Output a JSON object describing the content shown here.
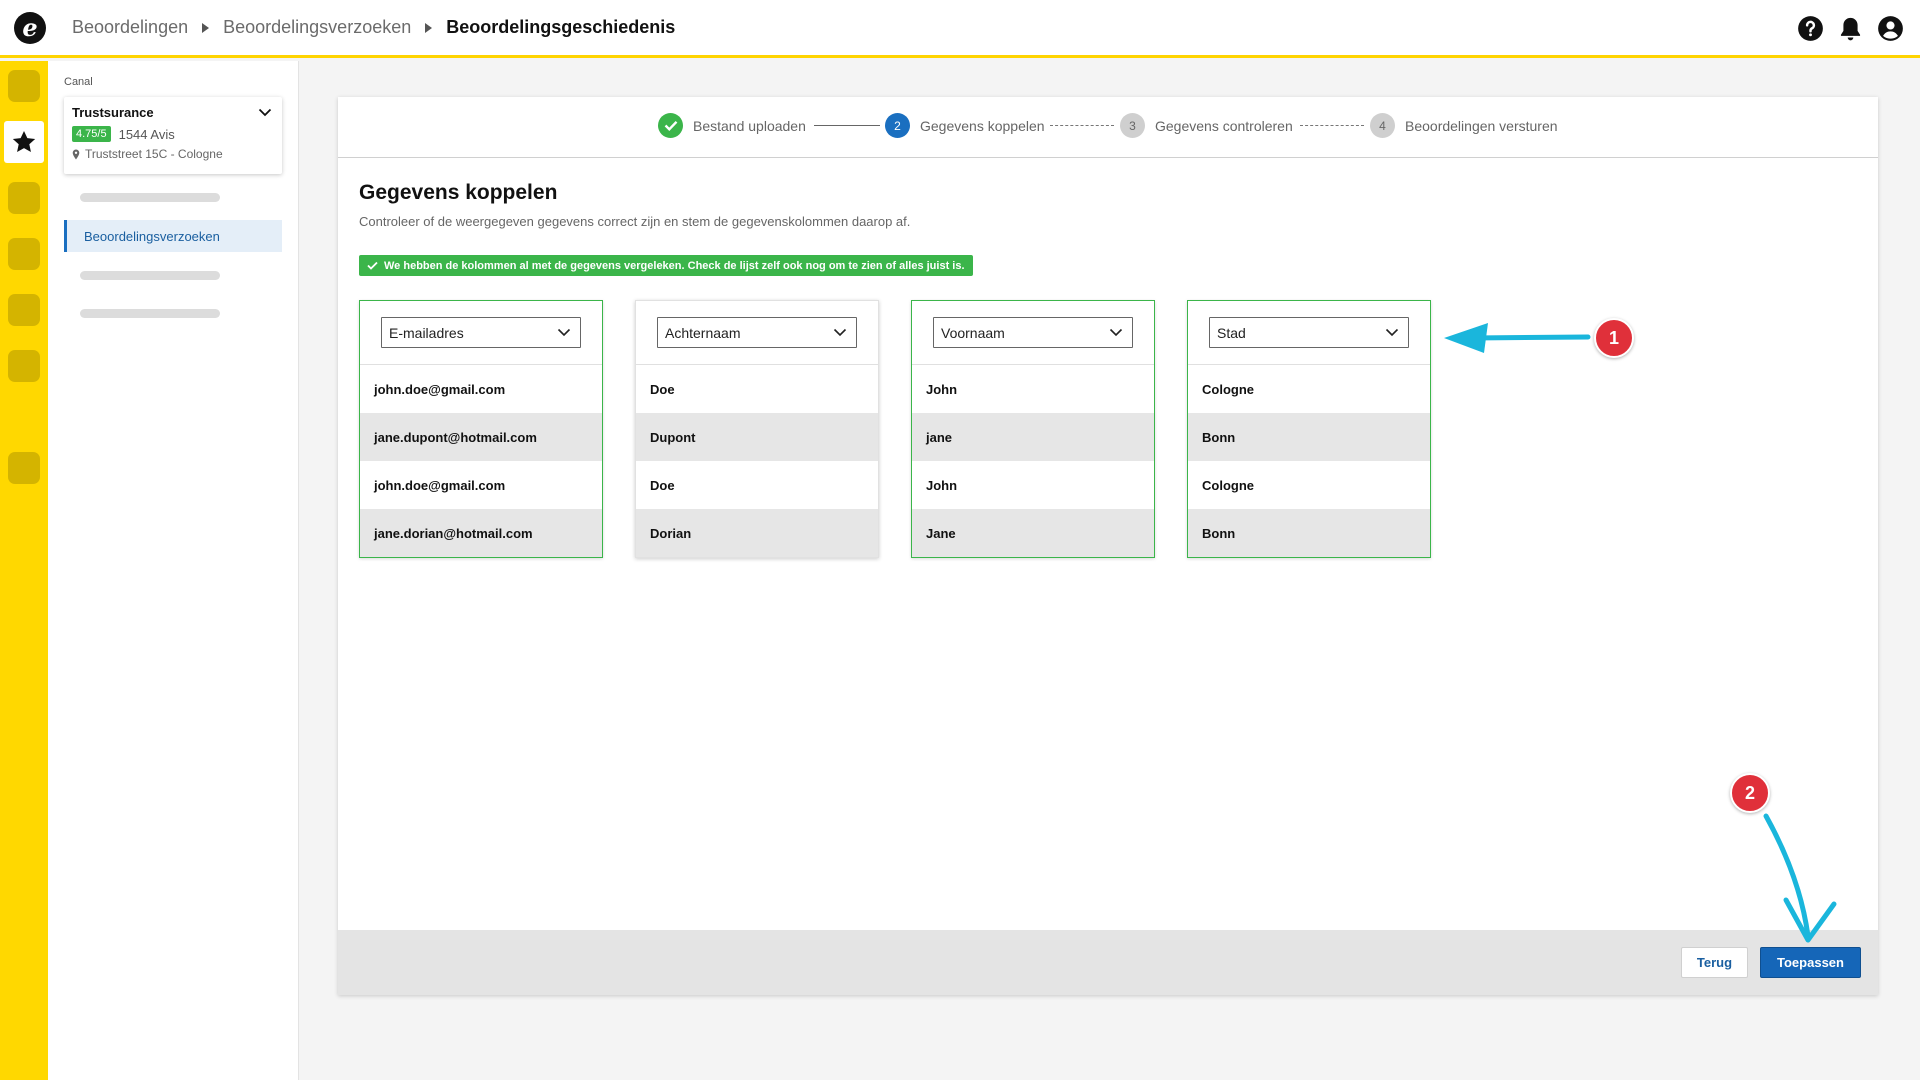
{
  "header": {
    "logo_letter": "e",
    "breadcrumbs": [
      "Beoordelingen",
      "Beoordelingsverzoeken",
      "Beoordelingsgeschiedenis"
    ],
    "icons": [
      "help-icon",
      "bell-icon",
      "user-icon"
    ]
  },
  "rail": {
    "active_icon": "star-icon"
  },
  "sidebar": {
    "section_label": "Canal",
    "company": {
      "name": "Trustsurance",
      "rating": "4.75/5",
      "reviews": "1544 Avis",
      "address": "Truststreet 15C - Cologne"
    },
    "active_item": "Beoordelingsverzoeken"
  },
  "stepper": {
    "steps": [
      {
        "number": "1",
        "label": "Bestand uploaden",
        "state": "done"
      },
      {
        "number": "2",
        "label": "Gegevens koppelen",
        "state": "active"
      },
      {
        "number": "3",
        "label": "Gegevens controleren",
        "state": "todo"
      },
      {
        "number": "4",
        "label": "Beoordelingen versturen",
        "state": "todo"
      }
    ]
  },
  "main": {
    "title": "Gegevens koppelen",
    "subtitle": "Controleer of de weergegeven gegevens correct zijn en stem de gegevenskolommen daarop af.",
    "success_message": "We hebben de kolommen al met de gegevens vergeleken. Check de lijst zelf ook nog om te zien of alles juist is.",
    "columns": [
      {
        "header": "E-mailadres",
        "matched": true,
        "values": [
          "john.doe@gmail.com",
          "jane.dupont@hotmail.com",
          "john.doe@gmail.com",
          "jane.dorian@hotmail.com"
        ]
      },
      {
        "header": "Achternaam",
        "matched": false,
        "values": [
          "Doe",
          "Dupont",
          "Doe",
          "Dorian"
        ]
      },
      {
        "header": "Voornaam",
        "matched": true,
        "values": [
          "John",
          "jane",
          "John",
          "Jane"
        ]
      },
      {
        "header": "Stad",
        "matched": true,
        "values": [
          "Cologne",
          "Bonn",
          "Cologne",
          "Bonn"
        ]
      }
    ]
  },
  "footer": {
    "back_label": "Terug",
    "apply_label": "Toepassen"
  },
  "annotations": {
    "marker_1": "1",
    "marker_2": "2",
    "arrow_color": "#1ab6dc",
    "marker_color": "#e0303a"
  },
  "colors": {
    "brand_yellow": "#ffd800",
    "success_green": "#3bb54a",
    "primary_blue": "#1566b8"
  }
}
